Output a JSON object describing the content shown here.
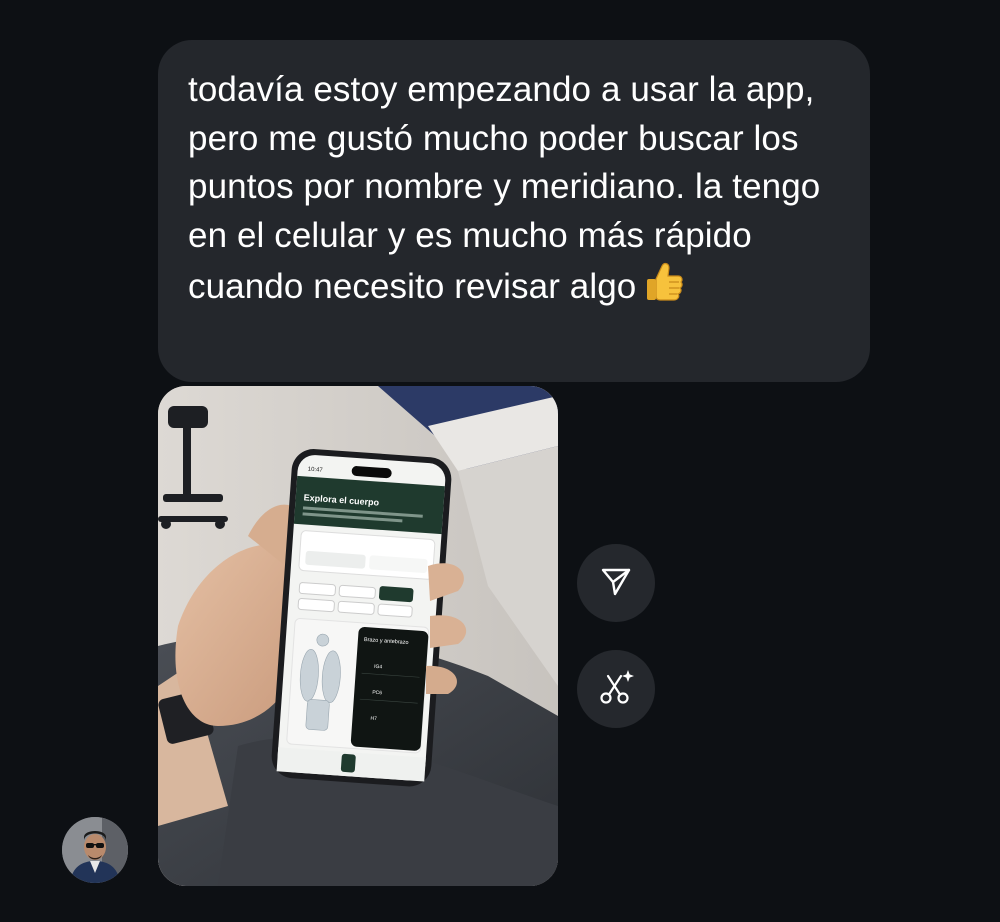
{
  "message": {
    "text": "todavía estoy empezando a usar la app, pero me gustó mucho poder buscar los puntos por nombre y meridiano. la tengo en el celular y es mucho más rápido cuando necesito revisar algo",
    "emoji": "thumbs-up-emoji"
  },
  "attachment": {
    "type": "photo",
    "phone_screen": {
      "time": "10:47",
      "title": "Explora el cuerpo",
      "panel_title": "Brazo y antebrazo",
      "points": [
        "IG4",
        "PC6",
        "H7"
      ]
    }
  },
  "actions": {
    "share_icon": "send-icon",
    "remix_icon": "scissors-sparkle-icon"
  },
  "sender": {
    "avatar_icon": "avatar"
  },
  "colors": {
    "background": "#0d1014",
    "bubble": "#24272c",
    "text": "#ffffff",
    "action_button": "#25282d"
  }
}
